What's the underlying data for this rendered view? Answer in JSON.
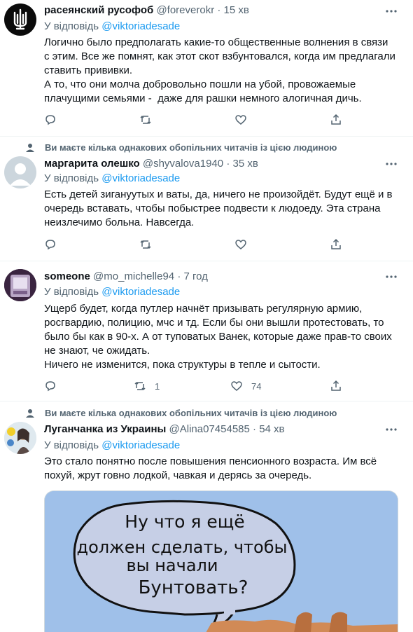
{
  "reply_prefix": "У відповідь",
  "social_context": "Ви маєте кілька однакових обопільних читачів із цією людиною",
  "tweets": [
    {
      "name": "расеянский русофоб",
      "handle": "@foreverokr",
      "time": "· 15 хв",
      "reply_to": "@viktoriadesade",
      "text": "Логично было предполагать какие-то общественные волнения в связи\nс этим. Все же помнят, как этот скот взбунтовался, когда им предлагали\nставить прививки.\nА то, что они молча добровольно пошли на убой, провожаемые\nплачущими семьями -  даже для рашки немного алогичная дичь.",
      "retweets": "",
      "likes": ""
    },
    {
      "name": "маргарита олешко",
      "handle": "@shyvalova1940",
      "time": "· 35 хв",
      "reply_to": "@viktoriadesade",
      "text": "Есть детей зигануутых и ваты, да, ничего не произойдёт. Будут ещё и в\nочередь вставать, чтобы побыстрее подвести к людоеду. Эта страна\nнеизлечимо больна. Навсегда.",
      "retweets": "",
      "likes": ""
    },
    {
      "name": "someone",
      "handle": "@mo_michelle94",
      "time": "· 7 год",
      "reply_to": "@viktoriadesade",
      "text": "Ущерб будет, когда путлер начнёт призывать регулярную армию,\nросгвардию, полицию, мчс и тд. Если бы они вышли протестовать, то\nбыло бы как в 90-х. А от туповатых Ванек, которые даже прав-то своих\nне знают, че ожидать.\nНичего не изменится, пока структуры в тепле и сытости.",
      "retweets": "1",
      "likes": "74"
    },
    {
      "name": "Луганчанка из Украины",
      "handle": "@Alina07454585",
      "time": "· 54 хв",
      "reply_to": "@viktoriadesade",
      "text": "Это стало понятно после повышения пенсионного возраста. Им всё\nпохуй, жрут говно лодкой, чавкая и дерясь за очередь.",
      "retweets": "",
      "likes": ""
    }
  ],
  "cartoon_text": [
    "Ну что я ещё",
    "должен сделать, чтобы",
    "вы начали",
    "Бунтовать?"
  ],
  "colors": {
    "accent": "#1d9bf0",
    "secondary_text": "#536471",
    "divider": "#eff3f4"
  }
}
